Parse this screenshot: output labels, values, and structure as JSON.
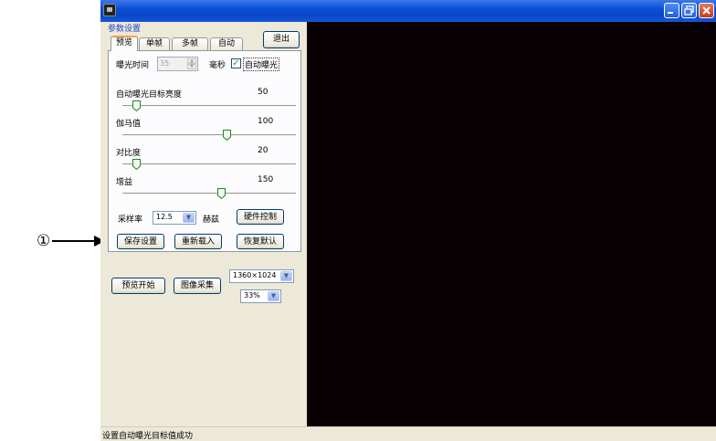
{
  "annotation": {
    "number": "①"
  },
  "window": {
    "titlebar_color": "#0a46c8",
    "icons": [
      "app-icon",
      "minimize-icon",
      "restore-icon",
      "close-icon"
    ]
  },
  "panel": {
    "group_label": "参数设置",
    "tabs": [
      {
        "label": "预览",
        "active": true
      },
      {
        "label": "单帧",
        "active": false
      },
      {
        "label": "多帧",
        "active": false
      },
      {
        "label": "自动",
        "active": false
      }
    ],
    "exit_label": "退出",
    "exposure": {
      "label": "曝光时间",
      "value": "35",
      "unit": "毫秒",
      "auto_label": "自动曝光",
      "auto_checked": true
    },
    "sliders": [
      {
        "label": "自动曝光目标亮度",
        "value": "50",
        "position": 0.08
      },
      {
        "label": "伽马值",
        "value": "100",
        "position": 0.6
      },
      {
        "label": "对比度",
        "value": "20",
        "position": 0.08
      },
      {
        "label": "增益",
        "value": "150",
        "position": 0.57
      }
    ],
    "sampling": {
      "label": "采样率",
      "value": "12.5",
      "unit": "赫兹",
      "hardware_button": "硬件控制"
    },
    "buttons": {
      "save": "保存设置",
      "reload": "重新载入",
      "restore": "恢复默认"
    },
    "preview_start": "预览开始",
    "capture": "图像采集",
    "resolution": "1360×1024",
    "zoom": "33%"
  },
  "status": {
    "text": "设置自动曝光目标值成功"
  }
}
